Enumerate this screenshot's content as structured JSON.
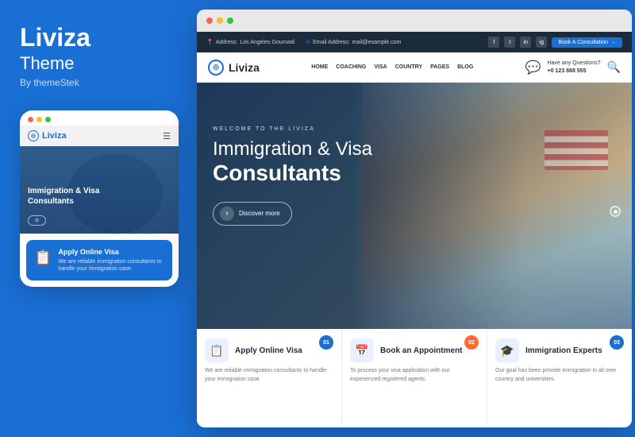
{
  "left": {
    "brand": "Liviza",
    "subtitle": "Theme",
    "by": "By themeStek",
    "mobile": {
      "dots": [
        "#ff5f57",
        "#ffbd2e",
        "#28ca41"
      ],
      "logo": "Liviza",
      "hero_pretitle": "",
      "hero_title": "Immigration & Visa",
      "hero_bold": "Consultants",
      "card_icon": "📋",
      "card_title": "Apply Online Visa",
      "card_desc": "We are reliable immigration consultants to handle your immigration case."
    }
  },
  "desktop": {
    "browser_dots": [
      "#ff5f57",
      "#ffbd2e",
      "#28ca41"
    ],
    "topbar": {
      "address_label": "Address:",
      "address_value": "Los Angeles Gournadi",
      "email_label": "Email Address:",
      "email_value": "mail@example.com",
      "book_btn": "Book A Consultation"
    },
    "nav": {
      "logo": "Liviza",
      "links": [
        "HOME",
        "COACHING",
        "VISA",
        "COUNTRY",
        "PAGES",
        "BLOG"
      ],
      "phone_question": "Have any Questions?",
      "phone_number": "+0 123 888 555"
    },
    "hero": {
      "pretitle": "WELCOME TO THE LIVIZA",
      "title_light": "Immigration & Visa",
      "title_bold": "Consultants",
      "button_text": "Discover more"
    },
    "cards": [
      {
        "badge": "01",
        "badge_color": "blue",
        "icon": "📋",
        "title": "Apply Online Visa",
        "desc": "We are reliable immigration consultants to handle your immigration case."
      },
      {
        "badge": "02",
        "badge_color": "orange",
        "icon": "📅",
        "title": "Book an Appointment",
        "desc": "To process your visa application with our experienced registered agents."
      },
      {
        "badge": "03",
        "badge_color": "blue",
        "icon": "🎓",
        "title": "Immigration Experts",
        "desc": "Our goal has been provide immigration in all over country and universities."
      }
    ]
  },
  "colors": {
    "primary": "#1a6fd4",
    "dark": "#1c2b3a",
    "orange": "#ff6b35"
  }
}
